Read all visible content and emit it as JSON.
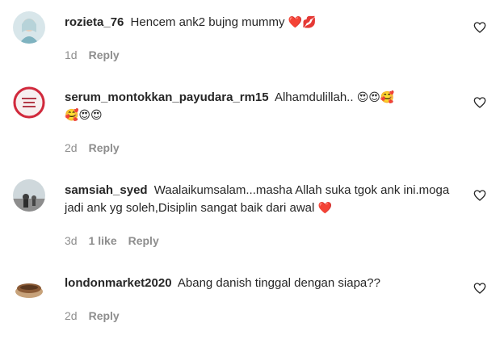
{
  "comments": [
    {
      "username": "rozieta_76",
      "text": "Hencem ank2 bujng mummy",
      "emojis": "❤️💋",
      "time": "1d",
      "likes": "",
      "reply": "Reply"
    },
    {
      "username": "serum_montokkan_payudara_rm15",
      "text": "Alhamdulillah..",
      "emojis": "😍😍🥰",
      "text2": "",
      "emojis2": "🥰😍😍",
      "time": "2d",
      "likes": "",
      "reply": "Reply"
    },
    {
      "username": "samsiah_syed",
      "text": "Waalaikumsalam...masha Allah suka tgok ank ini.moga jadi ank yg soleh,Disiplin sangat baik dari awal",
      "emojis": "❤️",
      "time": "3d",
      "likes": "1 like",
      "reply": "Reply"
    },
    {
      "username": "londonmarket2020",
      "text": "Abang danish tinggal dengan siapa??",
      "emojis": "",
      "time": "2d",
      "likes": "",
      "reply": "Reply"
    }
  ]
}
